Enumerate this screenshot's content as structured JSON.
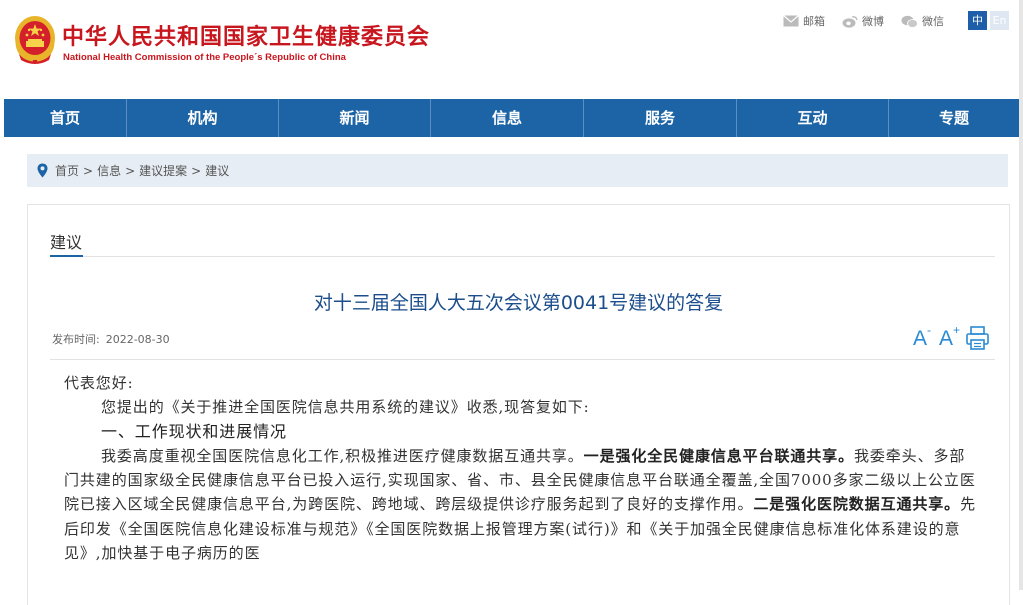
{
  "header": {
    "site_title": "中华人民共和国国家卫生健康委员会",
    "site_subtitle": "National Health Commission of the People´s Republic of China",
    "tools": [
      {
        "label": "邮箱",
        "icon": "mail-icon"
      },
      {
        "label": "微博",
        "icon": "weibo-icon"
      },
      {
        "label": "微信",
        "icon": "wechat-icon"
      }
    ],
    "lang_zh": "中",
    "lang_en": "En"
  },
  "nav": {
    "items": [
      "首页",
      "机构",
      "新闻",
      "信息",
      "服务",
      "互动",
      "专题"
    ]
  },
  "breadcrumb": {
    "items": [
      "首页",
      "信息",
      "建议提案",
      "建议"
    ],
    "separator": ">"
  },
  "section": {
    "title": "建议"
  },
  "article": {
    "title": "对十三届全国人大五次会议第0041号建议的答复",
    "date_label": "发布时间:",
    "date": "2022-08-30",
    "font_increase": "A",
    "font_decrease": "A",
    "font_plus": "+",
    "font_minus": "-",
    "salutation": "代表您好:",
    "intro": "您提出的《关于推进全国医院信息共用系统的建议》收悉,现答复如下:",
    "heading1": "一、工作现状和进展情况",
    "para1_a": "我委高度重视全国医院信息化工作,积极推进医疗健康数据互通共享。",
    "para1_b": "一是强化全民健康信息平台联通共享。",
    "para1_c": "我委牵头、多部门共建的国家级全民健康信息平台已投入运行,实现国家、省、市、县全民健康信息平台联通全覆盖,全国7000多家二级以上公立医院已接入区域全民健康信息平台,为跨医院、跨地域、跨层级提供诊疗服务起到了良好的支撑作用。",
    "para1_d": "二是强化医院数据互通共享。",
    "para1_e": "先后印发《全国医院信息化建设标准与规范》《全国医院数据上报管理方案(试行)》和《关于加强全民健康信息标准化体系建设的意见》,加快基于电子病历的医"
  },
  "colors": {
    "brand_red": "#c8161e",
    "nav_blue": "#1c64a6",
    "title_blue": "#1c4e8c",
    "tool_blue": "#2a8ad3"
  }
}
